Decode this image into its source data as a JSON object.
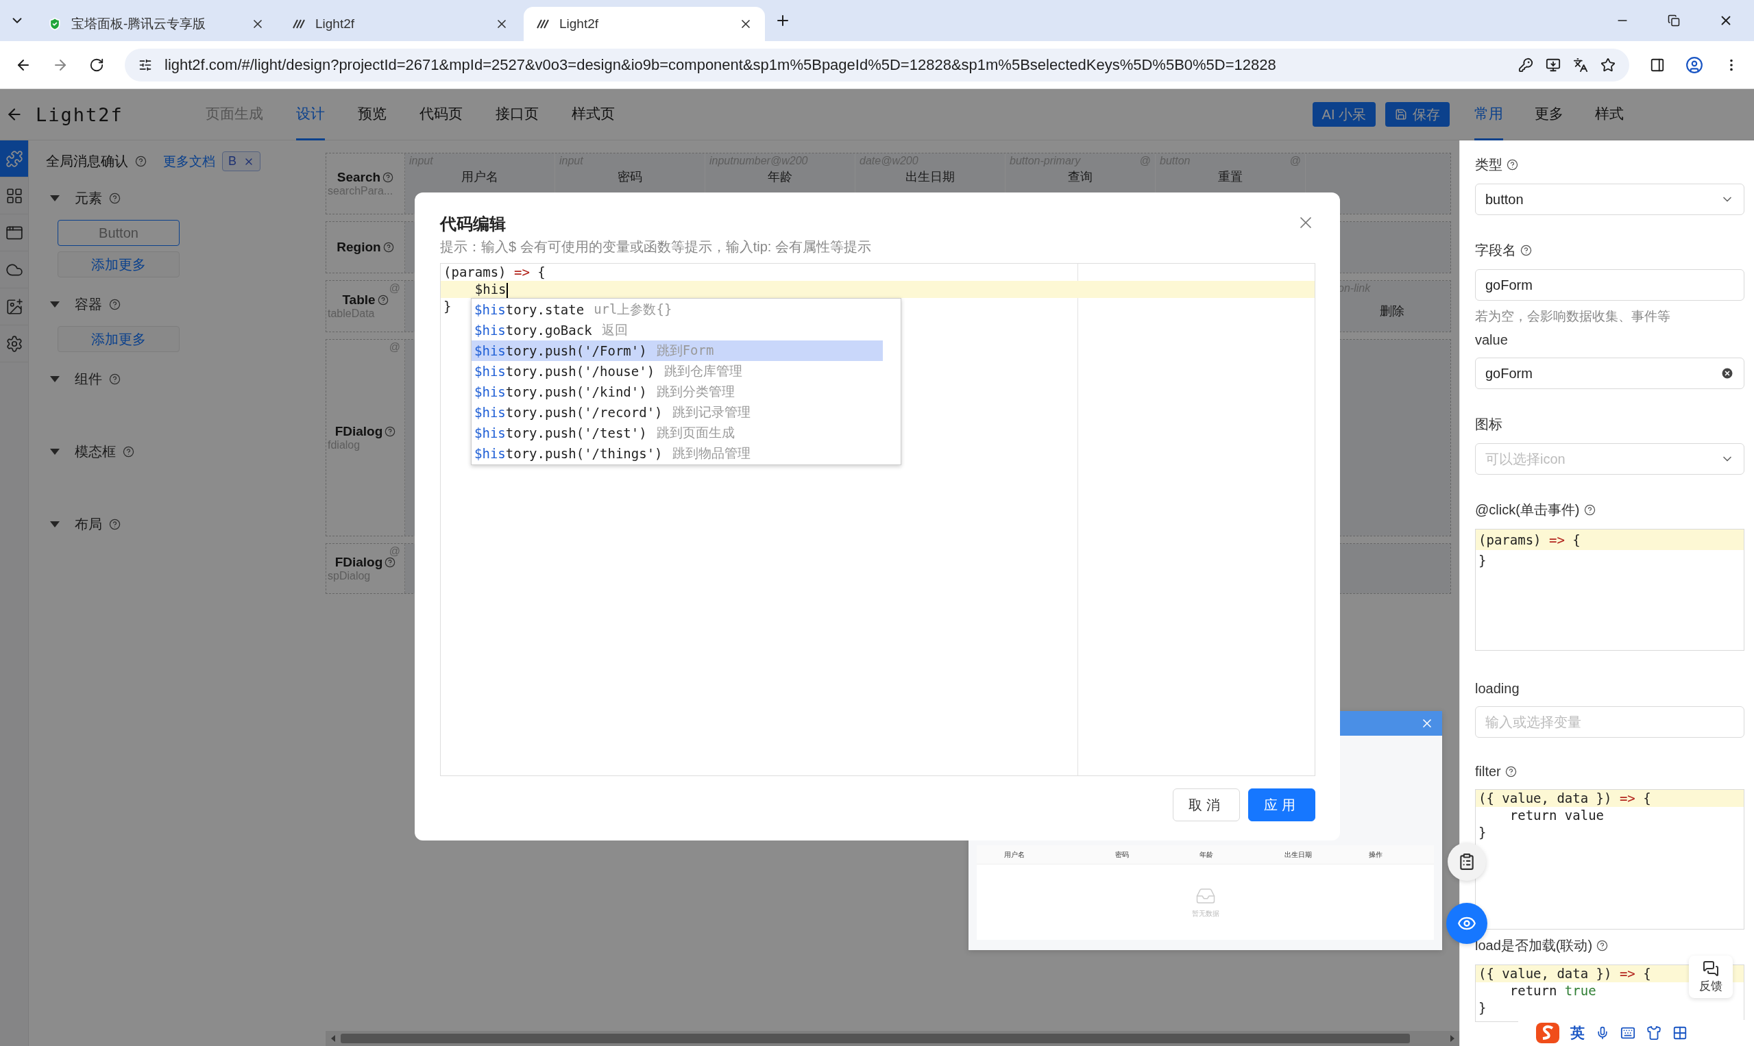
{
  "browser": {
    "tabs": [
      {
        "title": "宝塔面板-腾讯云专享版",
        "kind": "shield",
        "selected": false
      },
      {
        "title": "Light2f",
        "kind": "logo",
        "selected": false
      },
      {
        "title": "Light2f",
        "kind": "logo",
        "selected": true
      }
    ],
    "url": "light2f.com/#/light/design?projectId=2671&mpId=2527&v0o3=design&io9b=component&sp1m%5BpageId%5D=12828&sp1m%5BselectedKeys%5D%5B0%5D=12828"
  },
  "header": {
    "title": "Light2f",
    "nav": [
      {
        "label": "页面生成",
        "selected": false,
        "disabled": true
      },
      {
        "label": "设计",
        "selected": true,
        "disabled": false
      },
      {
        "label": "预览",
        "selected": false,
        "disabled": false
      },
      {
        "label": "代码页",
        "selected": false,
        "disabled": false
      },
      {
        "label": "接口页",
        "selected": false,
        "disabled": false
      },
      {
        "label": "样式页",
        "selected": false,
        "disabled": false
      }
    ],
    "actions": [
      {
        "label": "AI 小呆",
        "kind": "ai"
      },
      {
        "label": "保存",
        "kind": "save"
      }
    ],
    "panel_tabs": [
      {
        "label": "常用",
        "selected": true
      },
      {
        "label": "更多",
        "selected": false
      },
      {
        "label": "样式",
        "selected": false
      }
    ]
  },
  "rail": [
    {
      "kind": "puzzle",
      "selected": true
    },
    {
      "kind": "apps",
      "selected": false
    },
    {
      "kind": "window",
      "selected": false
    },
    {
      "kind": "cloud",
      "selected": false
    },
    {
      "kind": "image",
      "selected": false
    },
    {
      "kind": "settings",
      "selected": false
    }
  ],
  "left_panel": {
    "title": "全局消息确认",
    "link": "更多文档",
    "tag": "B",
    "sections": [
      {
        "title": "元素",
        "expanded": true,
        "items": [
          "Button"
        ],
        "add": "添加更多"
      },
      {
        "title": "容器",
        "expanded": true,
        "add": "添加更多"
      },
      {
        "title": "组件",
        "expanded": true
      },
      {
        "title": "模态框",
        "expanded": true
      },
      {
        "title": "布局",
        "expanded": true
      }
    ]
  },
  "canvas": {
    "rows": [
      {
        "kind": "search",
        "title": "Search",
        "var": "searchPara...",
        "fields": [
          {
            "type": "input",
            "label": "用户名"
          },
          {
            "type": "input",
            "label": "密码"
          },
          {
            "type": "inputnumber@w200",
            "label": "年龄"
          },
          {
            "type": "date@w200",
            "label": "出生日期"
          },
          {
            "type": "button-primary",
            "label": "查询",
            "corner": "@"
          },
          {
            "type": "button",
            "label": "重置",
            "corner": "@"
          }
        ]
      },
      {
        "kind": "region",
        "title": "Region"
      },
      {
        "kind": "table",
        "title": "Table",
        "var": "tableData",
        "corner": "@",
        "link_type": "on-link",
        "action": "删除"
      },
      {
        "kind": "dialog",
        "title": "FDialog",
        "var": "fdialog",
        "corner": "@"
      },
      {
        "kind": "dialog",
        "title": "FDialog",
        "var": "spDialog",
        "corner": "@"
      }
    ],
    "preview": {
      "columns": [
        "用户名",
        "密码",
        "年龄",
        "出生日期",
        "操作"
      ],
      "empty": "暂无数据"
    }
  },
  "modal": {
    "title": "代码编辑",
    "hint": "提示：输入$ 会有可使用的变量或函数等提示，输入tip: 会有属性等提示",
    "lines": [
      {
        "active": false,
        "tokens": [
          {
            "text": "(params) ",
            "kind": "plain"
          },
          {
            "text": "=>",
            "kind": "operator"
          },
          {
            "text": " {",
            "kind": "plain"
          }
        ]
      },
      {
        "active": true,
        "tokens": [
          {
            "text": "    $his",
            "kind": "plain"
          }
        ]
      },
      {
        "active": false,
        "tokens": [
          {
            "text": "}",
            "kind": "plain"
          }
        ]
      }
    ],
    "suggestions": [
      {
        "match": "$his",
        "rest": "tory.state",
        "desc": "url上参数{}",
        "selected": false
      },
      {
        "match": "$his",
        "rest": "tory.goBack",
        "desc": "返回",
        "selected": false
      },
      {
        "match": "$his",
        "rest": "tory.push('/Form')",
        "desc": "跳到Form",
        "selected": true
      },
      {
        "match": "$his",
        "rest": "tory.push('/house')",
        "desc": "跳到仓库管理",
        "selected": false
      },
      {
        "match": "$his",
        "rest": "tory.push('/kind')",
        "desc": "跳到分类管理",
        "selected": false
      },
      {
        "match": "$his",
        "rest": "tory.push('/record')",
        "desc": "跳到记录管理",
        "selected": false
      },
      {
        "match": "$his",
        "rest": "tory.push('/test')",
        "desc": "跳到页面生成",
        "selected": false
      },
      {
        "match": "$his",
        "rest": "tory.push('/things')",
        "desc": "跳到物品管理",
        "selected": false
      }
    ],
    "buttons": [
      {
        "label": "取消",
        "kind": "default"
      },
      {
        "label": "应用",
        "kind": "primary"
      }
    ]
  },
  "properties": {
    "fields": [
      {
        "kind": "select",
        "label": "类型",
        "help": true,
        "value": "button"
      },
      {
        "kind": "input",
        "label": "字段名",
        "help": true,
        "value": "goForm",
        "note": "若为空，会影响数据收集、事件等",
        "clearable": false
      },
      {
        "kind": "input",
        "label": "value",
        "help": false,
        "value": "goForm",
        "clearable": true
      },
      {
        "kind": "select",
        "label": "图标",
        "help": false,
        "placeholder": "可以选择icon"
      },
      {
        "kind": "code",
        "label": "@click(单击事件)",
        "help": true,
        "lines": [
          {
            "active": true,
            "tokens": [
              {
                "text": "(params) ",
                "kind": "plain"
              },
              {
                "text": "=>",
                "kind": "operator"
              },
              {
                "text": " {",
                "kind": "plain"
              }
            ]
          },
          {
            "active": false,
            "tokens": [
              {
                "text": "}",
                "kind": "plain"
              }
            ]
          }
        ]
      },
      {
        "kind": "input",
        "label": "loading",
        "help": false,
        "placeholder": "输入或选择变量",
        "clearable": false
      },
      {
        "kind": "code",
        "label": "filter",
        "help": true,
        "lines": [
          {
            "active": true,
            "tokens": [
              {
                "text": "({ value, data }) ",
                "kind": "plain"
              },
              {
                "text": "=>",
                "kind": "operator"
              },
              {
                "text": " {",
                "kind": "plain"
              }
            ]
          },
          {
            "active": false,
            "tokens": [
              {
                "text": "    return value",
                "kind": "plain"
              }
            ]
          },
          {
            "active": false,
            "tokens": [
              {
                "text": "}",
                "kind": "plain"
              }
            ]
          }
        ]
      },
      {
        "kind": "code",
        "label": "load是否加载(联动)",
        "help": true,
        "lines": [
          {
            "active": true,
            "tokens": [
              {
                "text": "({ value, data }) ",
                "kind": "plain"
              },
              {
                "text": "=>",
                "kind": "operator"
              },
              {
                "text": " {",
                "kind": "plain"
              }
            ]
          },
          {
            "active": false,
            "tokens": [
              {
                "text": "    return ",
                "kind": "plain"
              },
              {
                "text": "true",
                "kind": "literal"
              }
            ]
          },
          {
            "active": false,
            "tokens": [
              {
                "text": "}",
                "kind": "plain"
              }
            ]
          }
        ]
      }
    ]
  },
  "floating": {
    "feedback": "反馈"
  },
  "ime": {
    "mode": "英"
  }
}
